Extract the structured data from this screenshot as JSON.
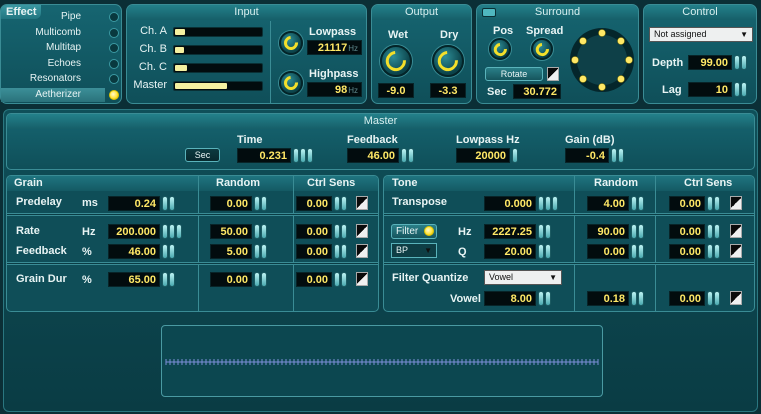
{
  "effect": {
    "title": "Effect",
    "items": [
      {
        "label": "Pipe",
        "active": false
      },
      {
        "label": "Multicomb",
        "active": false
      },
      {
        "label": "Multitap",
        "active": false
      },
      {
        "label": "Echoes",
        "active": false
      },
      {
        "label": "Resonators",
        "active": false
      },
      {
        "label": "Aetherizer",
        "active": true
      }
    ]
  },
  "input": {
    "title": "Input",
    "channels": [
      {
        "label": "Ch. A",
        "level": 0.12
      },
      {
        "label": "Ch. B",
        "level": 0.1
      },
      {
        "label": "Ch. C",
        "level": 0.14
      },
      {
        "label": "Master",
        "level": 0.6
      }
    ],
    "lowpass_label": "Lowpass",
    "lowpass_value": "21117",
    "lowpass_unit": "Hz",
    "highpass_label": "Highpass",
    "highpass_value": "98",
    "highpass_unit": "Hz"
  },
  "output": {
    "title": "Output",
    "wet_label": "Wet",
    "wet_value": "-9.0",
    "dry_label": "Dry",
    "dry_value": "-3.3"
  },
  "surround": {
    "title": "Surround",
    "pos_label": "Pos",
    "spread_label": "Spread",
    "rotate_label": "Rotate",
    "sec_label": "Sec",
    "sec_value": "30.772"
  },
  "control": {
    "title": "Control",
    "dropdown": "Not assigned",
    "depth_label": "Depth",
    "depth_value": "99.00",
    "lag_label": "Lag",
    "lag_value": "10"
  },
  "master": {
    "title": "Master",
    "sec_button": "Sec",
    "time_label": "Time",
    "time_value": "0.231",
    "feedback_label": "Feedback",
    "feedback_value": "46.00",
    "lowpass_label": "Lowpass Hz",
    "lowpass_value": "20000",
    "gain_label": "Gain (dB)",
    "gain_value": "-0.4"
  },
  "grain": {
    "header": "Grain",
    "random_header": "Random",
    "ctrl_header": "Ctrl Sens",
    "predelay_label": "Predelay",
    "predelay_unit": "ms",
    "predelay_value": "0.24",
    "predelay_random": "0.00",
    "predelay_ctrl": "0.00",
    "rate_label": "Rate",
    "rate_unit": "Hz",
    "rate_value": "200.000",
    "rate_random": "50.00",
    "rate_ctrl": "0.00",
    "feedback_label": "Feedback",
    "feedback_unit": "%",
    "feedback_value": "46.00",
    "feedback_random": "5.00",
    "feedback_ctrl": "0.00",
    "dur_label": "Grain Dur",
    "dur_unit": "%",
    "dur_value": "65.00",
    "dur_random": "0.00",
    "dur_ctrl": "0.00"
  },
  "tone": {
    "header": "Tone",
    "random_header": "Random",
    "ctrl_header": "Ctrl Sens",
    "transpose_label": "Transpose",
    "transpose_value": "0.000",
    "transpose_random": "4.00",
    "transpose_ctrl": "0.00",
    "filter_button": "Filter",
    "filter_type": "BP",
    "hz_label": "Hz",
    "hz_value": "2227.25",
    "hz_random": "90.00",
    "hz_ctrl": "0.00",
    "q_label": "Q",
    "q_value": "20.00",
    "q_random": "0.00",
    "q_ctrl": "0.00",
    "quantize_label": "Filter Quantize",
    "quantize_select": "Vowel",
    "vowel_label": "Vowel",
    "vowel_value": "8.00",
    "vowel_random": "0.18",
    "vowel_ctrl": "0.00"
  },
  "colors": {
    "panel": "#166571",
    "value_text": "#ffe866",
    "led_on": "#ffe233",
    "border": "#3a8c95",
    "waveform": "#7d8fd8"
  }
}
